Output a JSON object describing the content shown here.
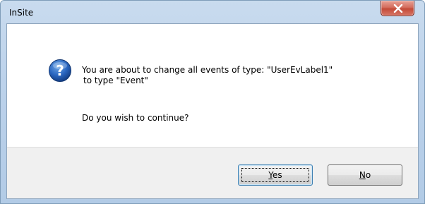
{
  "window": {
    "title": "InSite"
  },
  "dialog": {
    "message_line1": "You are about to change all events of type: \"UserEvLabel1\"",
    "message_line2": "to type \"Event\"",
    "question": "Do you wish to continue?",
    "icon": "question-icon"
  },
  "buttons": {
    "yes": {
      "mnemonic": "Y",
      "rest": "es"
    },
    "no": {
      "mnemonic": "N",
      "rest": "o"
    }
  },
  "colors": {
    "accent": "#3c7fb1",
    "close_button": "#c34a38",
    "icon_blue": "#1f5fb4"
  }
}
